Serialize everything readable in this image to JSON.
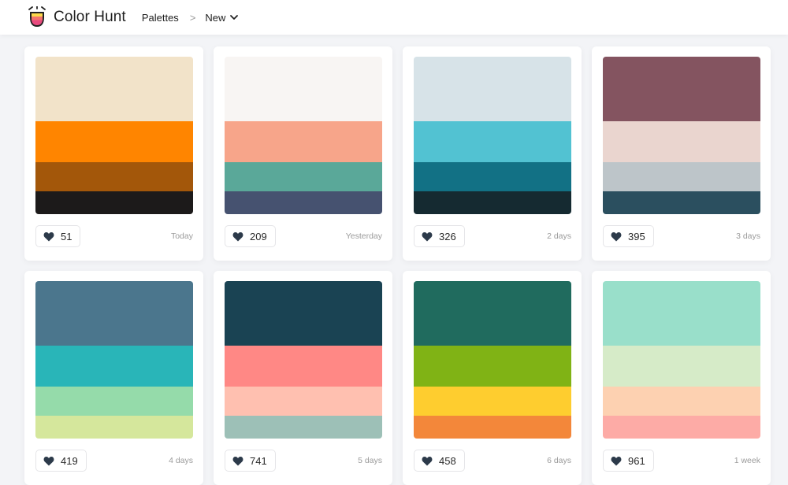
{
  "header": {
    "brand": "Color Hunt",
    "nav_palettes": "Palettes",
    "nav_separator": ">",
    "nav_current": "New"
  },
  "palettes": [
    {
      "colors": [
        "#F2E3C9",
        "#FF8500",
        "#A3570A",
        "#1C1A1A"
      ],
      "likes": "51",
      "date": "Today"
    },
    {
      "colors": [
        "#F8F5F3",
        "#F7A58A",
        "#5AA899",
        "#465270"
      ],
      "likes": "209",
      "date": "Yesterday"
    },
    {
      "colors": [
        "#D7E3E8",
        "#52C2D2",
        "#127185",
        "#152A31"
      ],
      "likes": "326",
      "date": "2 days"
    },
    {
      "colors": [
        "#845460",
        "#EAD5CF",
        "#BDC5C9",
        "#2B4F5F"
      ],
      "likes": "395",
      "date": "3 days"
    },
    {
      "colors": [
        "#4B768D",
        "#29B5B8",
        "#95DBAA",
        "#D5E79C"
      ],
      "likes": "419",
      "date": "4 days"
    },
    {
      "colors": [
        "#1A4353",
        "#FF8885",
        "#FFC0B0",
        "#9DC0B7"
      ],
      "likes": "741",
      "date": "5 days"
    },
    {
      "colors": [
        "#206B5E",
        "#80B315",
        "#FECD2F",
        "#F3873A"
      ],
      "likes": "458",
      "date": "6 days"
    },
    {
      "colors": [
        "#99DFCA",
        "#D6EBC8",
        "#FDD1B1",
        "#FDABA6"
      ],
      "likes": "961",
      "date": "1 week"
    }
  ],
  "icons": {
    "logo": "color-hunt-logo-icon",
    "chevron": "chevron-down-icon",
    "heart": "heart-icon"
  },
  "colors": {
    "heart": "#2C3A4A",
    "header_bg": "#FFFFFF",
    "page_bg": "#F3F4F7"
  }
}
